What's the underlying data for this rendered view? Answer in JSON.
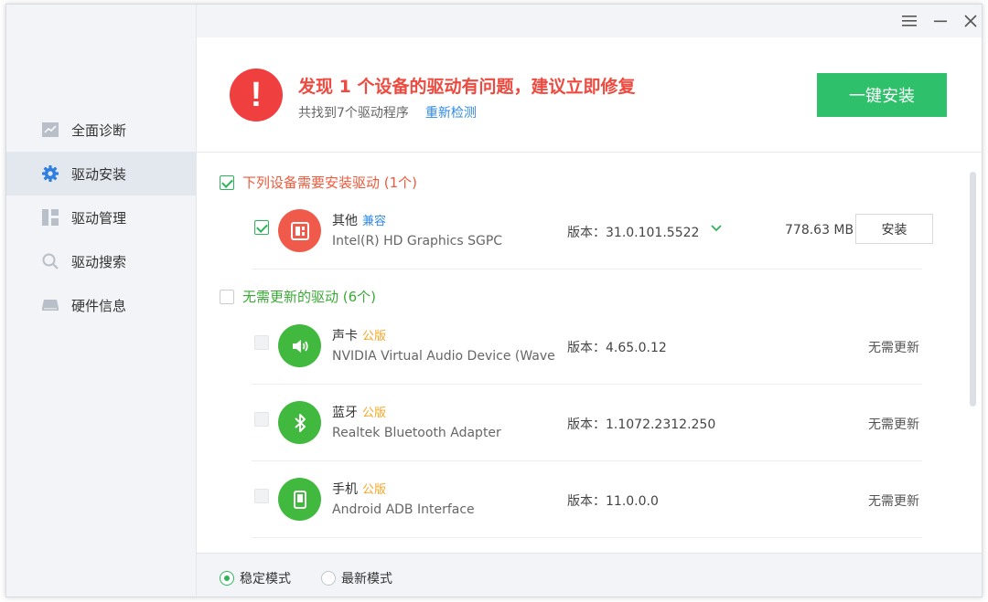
{
  "titlebar": {
    "menu_icon": "menu-icon",
    "minimize_icon": "minimize-icon",
    "close_icon": "close-icon"
  },
  "sidebar": {
    "items": [
      {
        "label": "全面诊断",
        "icon": "diagnosis-chart-icon",
        "active": false
      },
      {
        "label": "驱动安装",
        "icon": "gear-icon",
        "active": true
      },
      {
        "label": "驱动管理",
        "icon": "grid-icon",
        "active": false
      },
      {
        "label": "驱动搜索",
        "icon": "search-icon",
        "active": false
      },
      {
        "label": "硬件信息",
        "icon": "hardware-icon",
        "active": false
      }
    ]
  },
  "header": {
    "alert_symbol": "!",
    "title": "发现 1 个设备的驱动有问题，建议立即修复",
    "subtitle": "共找到7个驱动程序",
    "rescan_link": "重新检测",
    "install_all_button": "一键安装"
  },
  "groups": {
    "need_install": {
      "title": "下列设备需要安装驱动 (1个)",
      "checked": true,
      "items": [
        {
          "category": "其他",
          "tag": "兼容",
          "name": "Intel(R) HD Graphics SGPC",
          "version": "版本：31.0.101.5522",
          "size": "778.63 MB",
          "action": "安装",
          "checked": true,
          "icon": "display-adapter-icon"
        }
      ]
    },
    "no_update": {
      "title": "无需更新的驱动 (6个)",
      "checked": false,
      "items": [
        {
          "category": "声卡",
          "tag": "公版",
          "name": "NVIDIA Virtual Audio Device (Wave E",
          "version": "版本：4.65.0.12",
          "status": "无需更新",
          "icon": "speaker-icon"
        },
        {
          "category": "蓝牙",
          "tag": "公版",
          "name": "Realtek Bluetooth Adapter",
          "version": "版本：1.1072.2312.250",
          "status": "无需更新",
          "icon": "bluetooth-icon"
        },
        {
          "category": "手机",
          "tag": "公版",
          "name": "Android ADB Interface",
          "version": "版本：11.0.0.0",
          "status": "无需更新",
          "icon": "phone-icon"
        }
      ]
    }
  },
  "footer": {
    "mode_stable": "稳定模式",
    "mode_latest": "最新模式",
    "selected": "稳定模式"
  },
  "colors": {
    "accent_green": "#2fc06b",
    "alert_red": "#ef3f3f",
    "link_blue": "#2f8ae4",
    "tag_orange": "#f5a623"
  }
}
